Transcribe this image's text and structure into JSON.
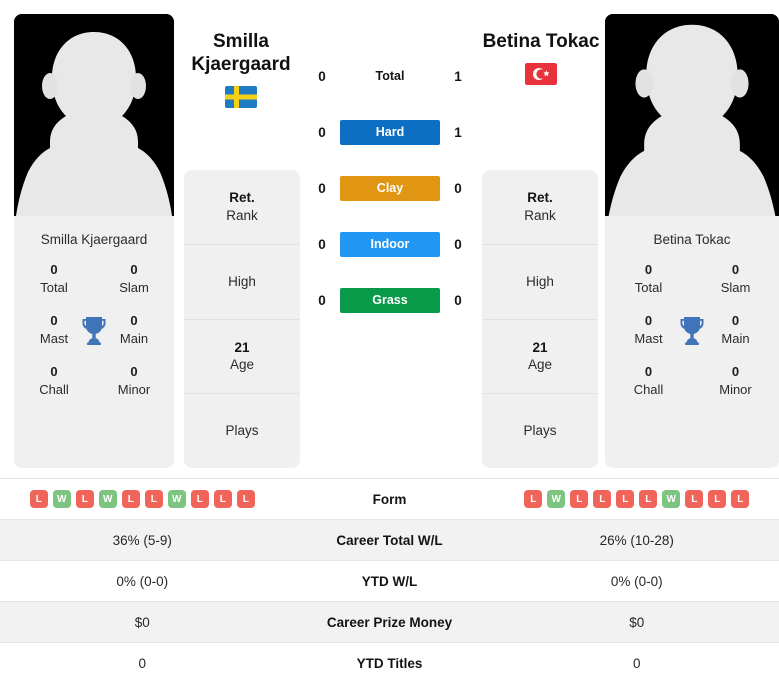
{
  "players": {
    "left": {
      "name": "Smilla Kjaergaard",
      "display_name_line1": "Smilla",
      "display_name_line2": "Kjaergaard",
      "country": "Sweden",
      "flag_icon": "sweden-flag-icon",
      "avatar_icon": "anonymous-player-avatar-icon",
      "trophies": [
        {
          "num": "0",
          "label": "Total"
        },
        {
          "num": "0",
          "label": "Slam"
        },
        {
          "num": "0",
          "label": "Mast"
        },
        {
          "num": "0",
          "label": "Main"
        },
        {
          "num": "0",
          "label": "Chall"
        },
        {
          "num": "0",
          "label": "Minor"
        }
      ],
      "info": [
        {
          "value": "Ret.",
          "label": "Rank"
        },
        {
          "value": "",
          "label": "High"
        },
        {
          "value": "21",
          "label": "Age"
        },
        {
          "value": "",
          "label": "Plays"
        }
      ],
      "form": [
        "L",
        "W",
        "L",
        "W",
        "L",
        "L",
        "W",
        "L",
        "L",
        "L"
      ]
    },
    "right": {
      "name": "Betina Tokac",
      "display_name_line1": "Betina Tokac",
      "display_name_line2": "",
      "country": "Turkey",
      "flag_icon": "turkey-flag-icon",
      "avatar_icon": "anonymous-player-avatar-icon",
      "trophies": [
        {
          "num": "0",
          "label": "Total"
        },
        {
          "num": "0",
          "label": "Slam"
        },
        {
          "num": "0",
          "label": "Mast"
        },
        {
          "num": "0",
          "label": "Main"
        },
        {
          "num": "0",
          "label": "Chall"
        },
        {
          "num": "0",
          "label": "Minor"
        }
      ],
      "info": [
        {
          "value": "Ret.",
          "label": "Rank"
        },
        {
          "value": "",
          "label": "High"
        },
        {
          "value": "21",
          "label": "Age"
        },
        {
          "value": "",
          "label": "Plays"
        }
      ],
      "form": [
        "L",
        "W",
        "L",
        "L",
        "L",
        "L",
        "W",
        "L",
        "L",
        "L"
      ]
    }
  },
  "head_to_head": [
    {
      "label": "Total",
      "left": "0",
      "right": "1",
      "color": ""
    },
    {
      "label": "Hard",
      "left": "0",
      "right": "1",
      "color": "#0d6fc4"
    },
    {
      "label": "Clay",
      "left": "0",
      "right": "0",
      "color": "#e09612"
    },
    {
      "label": "Indoor",
      "left": "0",
      "right": "0",
      "color": "#2196f3"
    },
    {
      "label": "Grass",
      "left": "0",
      "right": "0",
      "color": "#089949"
    }
  ],
  "stats_table": [
    {
      "label": "Form",
      "left": "",
      "right": "",
      "type": "form"
    },
    {
      "label": "Career Total W/L",
      "left": "36% (5-9)",
      "right": "26% (10-28)",
      "type": "text"
    },
    {
      "label": "YTD W/L",
      "left": "0% (0-0)",
      "right": "0% (0-0)",
      "type": "text"
    },
    {
      "label": "Career Prize Money",
      "left": "$0",
      "right": "$0",
      "type": "text"
    },
    {
      "label": "YTD Titles",
      "left": "0",
      "right": "0",
      "type": "text"
    }
  ],
  "colors": {
    "win": "#7cc47f",
    "loss": "#f0645a",
    "hard": "#0d6fc4",
    "clay": "#e09612",
    "indoor": "#2196f3",
    "grass": "#089949",
    "trophy": "#3f74b8",
    "card_bg": "#f0f0f0",
    "stripe_bg": "#f2f2f2"
  }
}
